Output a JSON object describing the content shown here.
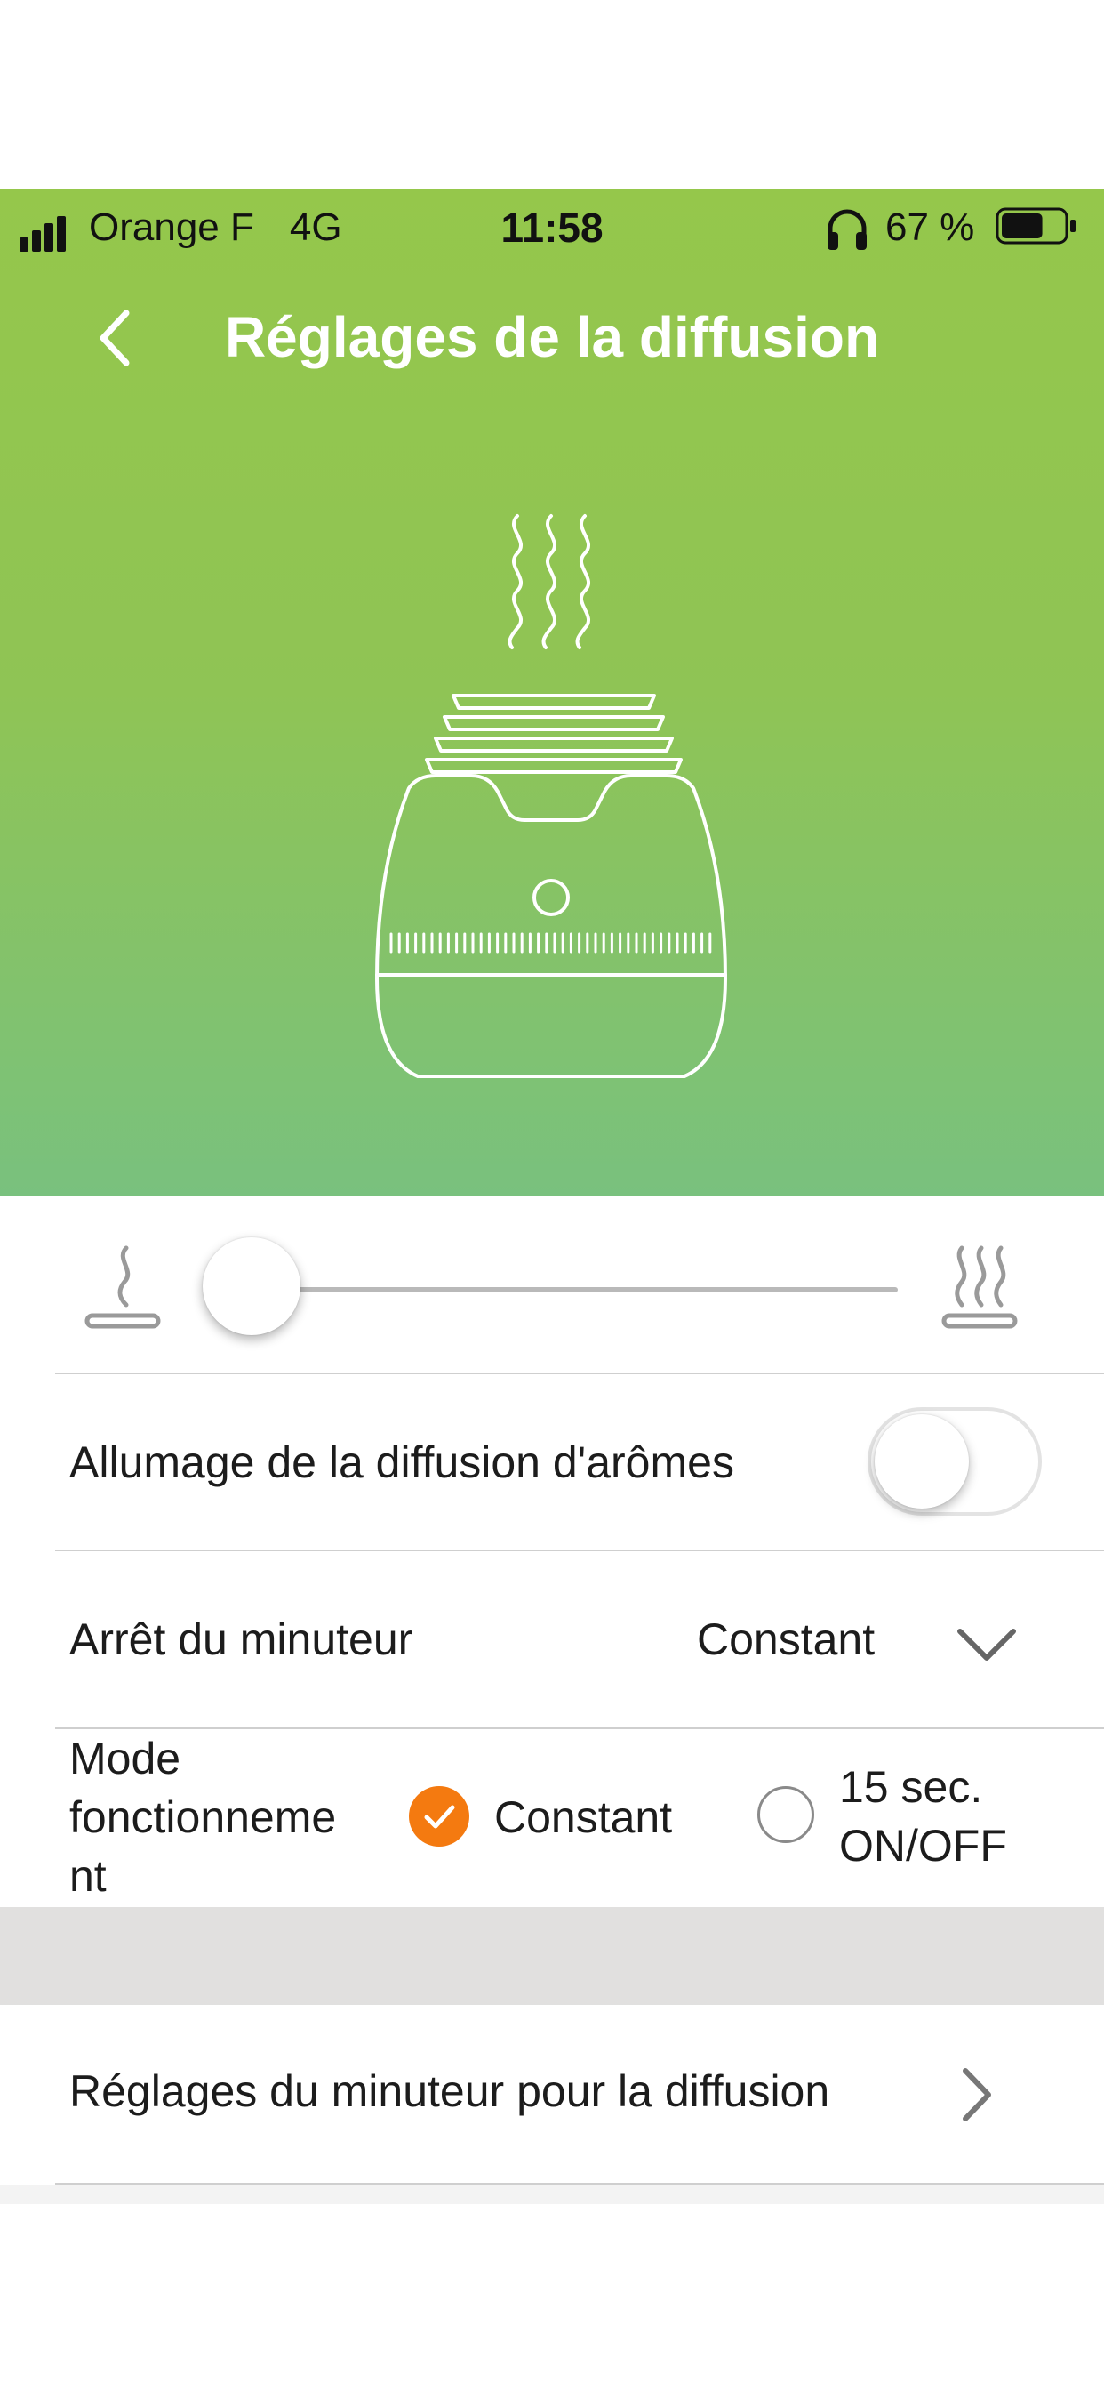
{
  "status_bar": {
    "carrier": "Orange F",
    "network": "4G",
    "time": "11:58",
    "battery_percent": "67 %",
    "signal_icon": "cellular-signal-icon",
    "headphones_icon": "headphones-icon",
    "battery_icon": "battery-icon",
    "battery_level": 0.67
  },
  "header": {
    "back_icon": "chevron-left-icon",
    "title": "Réglages de la diffusion"
  },
  "illustration": {
    "icon": "aroma-diffuser-illustration"
  },
  "intensity_slider": {
    "min_icon": "low-mist-icon",
    "max_icon": "high-mist-icon",
    "value_fraction": 0.0
  },
  "diffusion_toggle": {
    "label": "Allumage de la diffusion d'arômes",
    "on": false
  },
  "timer_stop": {
    "label": "Arrêt du minuteur",
    "selected": "Constant",
    "icon": "chevron-down-icon"
  },
  "operating_mode": {
    "label_lines": [
      "Mode",
      "fonctionneme",
      "nt"
    ],
    "options": [
      {
        "label_lines": [
          "Constant"
        ],
        "selected": true
      },
      {
        "label_lines": [
          "15 sec.",
          "ON/OFF"
        ],
        "selected": false
      }
    ]
  },
  "timer_settings": {
    "label": "Réglages du minuteur pour la diffusion",
    "icon": "chevron-right-icon"
  },
  "colors": {
    "gradient_top": "#95c74b",
    "gradient_bottom": "#79c17e",
    "accent_orange": "#f47a10",
    "divider": "#cfcfcf",
    "section_gray": "#e1e0df"
  }
}
